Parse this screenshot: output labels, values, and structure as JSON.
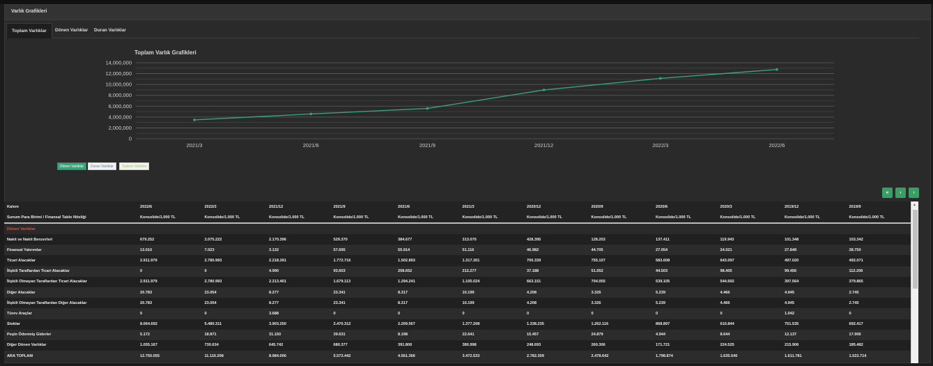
{
  "panel": {
    "title": "Varlık Grafikleri"
  },
  "tabs": [
    {
      "label": "Toplam Varlıklar",
      "active": true
    },
    {
      "label": "Dönen Varlıklar",
      "active": false
    },
    {
      "label": "Duran Varlıklar",
      "active": false
    }
  ],
  "chart_data": {
    "type": "line",
    "title": "Toplam Varlık Grafikleri",
    "xlabel": "",
    "ylabel": "",
    "categories": [
      "2021/3",
      "2021/6",
      "2021/9",
      "2021/12",
      "2022/3",
      "2022/6"
    ],
    "series": [
      {
        "values": [
          3472533,
          4561366,
          5573442,
          8984006,
          11116208,
          12750055
        ],
        "color": "#3aa37a"
      }
    ],
    "ylim": [
      0,
      14000000
    ],
    "yticks": [
      0,
      2000000,
      4000000,
      6000000,
      8000000,
      10000000,
      12000000,
      14000000
    ],
    "ytick_labels": [
      "0",
      "2,000,000",
      "4,000,000",
      "6,000,000",
      "8,000,000",
      "10,000,000",
      "12,000,000",
      "14,000,000"
    ],
    "grid": true
  },
  "legend": [
    {
      "label": "Dönen Varlıklar",
      "color": "#3aa37a"
    },
    {
      "label": "Duran Varlıklar",
      "color": "#5b7fb5"
    },
    {
      "label": "Toplam Varlıklar",
      "color": "#9ccc3c"
    }
  ],
  "pagination": {
    "first": "«",
    "prev": "‹",
    "next": "›"
  },
  "table": {
    "header_label": "Kalem",
    "subheader_label": "Sunum Para Birimi / Finansal Tablo Niteliği",
    "periods": [
      "2022/6",
      "2022/3",
      "2021/12",
      "2021/9",
      "2021/6",
      "2021/3",
      "2020/12",
      "2020/9",
      "2020/6",
      "2020/3",
      "2019/12",
      "2019/9"
    ],
    "basis": "Konsolide/1.000 TL",
    "section_label": "Dönen Varlıklar",
    "rows": [
      {
        "label": "Nakit ve Nakit Benzerleri",
        "values": [
          "679.252",
          "2.075.222",
          "2.170.396",
          "529.370",
          "384.677",
          "313.070",
          "428.395",
          "128.203",
          "137.411",
          "119.943",
          "101.348",
          "103.342"
        ]
      },
      {
        "label": "Finansal Yatırımlar",
        "values": [
          "13.010",
          "7.023",
          "3.132",
          "57.695",
          "55.914",
          "51.116",
          "46.982",
          "44.705",
          "27.054",
          "24.021",
          "27.848",
          "28.750"
        ]
      },
      {
        "label": "Ticari Alacaklar",
        "values": [
          "2.911.979",
          "2.780.993",
          "2.218.391",
          "1.772.716",
          "1.502.893",
          "1.317.301",
          "700.339",
          "755.107",
          "583.608",
          "643.097",
          "497.020",
          "492.071"
        ]
      },
      {
        "label": "İlişkili Taraflardan Ticari Alacaklar",
        "values": [
          "0",
          "0",
          "4.990",
          "93.603",
          "208.652",
          "212.277",
          "37.188",
          "51.052",
          "44.503",
          "98.405",
          "99.456",
          "112.206"
        ]
      },
      {
        "label": "İlişkili Olmayan Taraflardan Ticari Alacaklar",
        "values": [
          "2.911.979",
          "2.780.993",
          "2.213.401",
          "1.679.113",
          "1.294.241",
          "1.105.024",
          "663.151",
          "704.055",
          "539.105",
          "544.692",
          "397.564",
          "379.865"
        ]
      },
      {
        "label": "Diğer Alacaklar",
        "values": [
          "20.783",
          "23.054",
          "8.277",
          "23.341",
          "8.317",
          "10.199",
          "4.208",
          "3.326",
          "5.239",
          "4.466",
          "4.945",
          "2.745"
        ]
      },
      {
        "label": "İlişkili Olmayan Taraflardan Diğer Alacaklar",
        "values": [
          "20.783",
          "23.054",
          "8.277",
          "23.341",
          "8.317",
          "10.199",
          "4.208",
          "3.326",
          "5.239",
          "4.466",
          "4.945",
          "2.745"
        ]
      },
      {
        "label": "Türev Araçlar",
        "values": [
          "0",
          "0",
          "3.688",
          "0",
          "0",
          "0",
          "0",
          "0",
          "0",
          "0",
          "1.042",
          "0"
        ]
      },
      {
        "label": "Stoklar",
        "values": [
          "8.064.692",
          "5.480.311",
          "3.903.250",
          "2.470.312",
          "2.209.567",
          "1.377.208",
          "1.338.235",
          "1.262.116",
          "868.897",
          "610.844",
          "751.535",
          "692.417"
        ]
      },
      {
        "label": "Peşin Ödenmiş Giderler",
        "values": [
          "5.172",
          "18.871",
          "31.150",
          "39.631",
          "8.198",
          "22.641",
          "15.457",
          "24.879",
          "4.944",
          "8.644",
          "12.137",
          "17.906"
        ]
      },
      {
        "label": "Diğer Dönen Varlıklar",
        "values": [
          "1.055.167",
          "730.634",
          "645.742",
          "680.377",
          "391.800",
          "380.998",
          "248.693",
          "260.306",
          "171.721",
          "224.525",
          "215.906",
          "185.482"
        ]
      },
      {
        "label": "ARA TOPLAM",
        "values": [
          "12.750.055",
          "11.116.208",
          "8.984.006",
          "5.573.442",
          "4.561.366",
          "3.472.533",
          "2.782.309",
          "2.478.642",
          "1.798.874",
          "1.635.540",
          "1.611.781",
          "1.522.714"
        ]
      }
    ]
  }
}
